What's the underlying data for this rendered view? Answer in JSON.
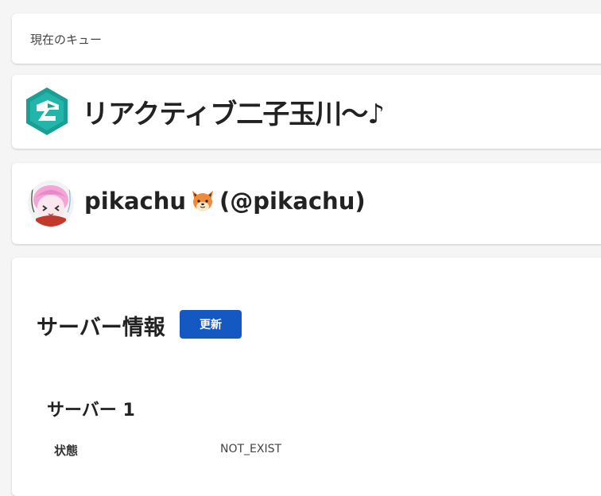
{
  "queue": {
    "label": "現在のキュー"
  },
  "app": {
    "title": "リアクティブ二子玉川〜♪",
    "logo_icon": "teal-hexagon-logo-icon"
  },
  "user": {
    "name": "pikachu",
    "emoji_icon": "fox-face-icon",
    "handle": "(@pikachu)",
    "avatar_icon": "anime-avatar"
  },
  "server_info": {
    "heading": "サーバー情報",
    "refresh_label": "更新",
    "button_color": "#1458c2",
    "server_name": "サーバー 1",
    "status_label": "状態",
    "status_value": "NOT_EXIST"
  }
}
